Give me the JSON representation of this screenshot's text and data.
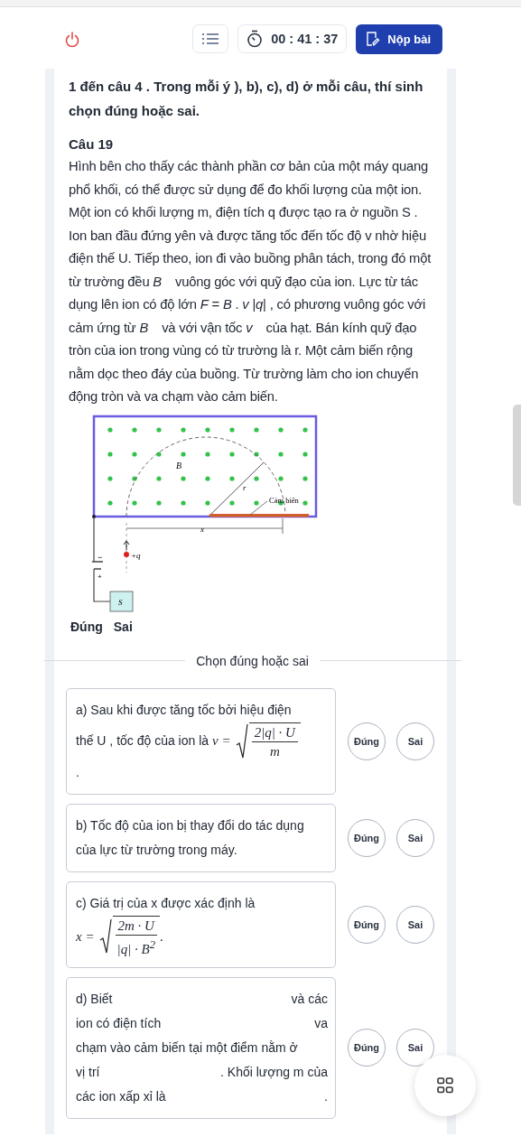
{
  "toolbar": {
    "timer": "00 : 41 : 37",
    "submit": "Nộp bài"
  },
  "instruction": "1 đến câu 4 . Trong mỗi ý     ), b), c), d) ở mỗi câu, thí sinh chọn đúng hoặc sai.",
  "question": {
    "title": "Câu 19",
    "paragraph": "Hình bên cho thấy các thành phần cơ bản của một máy quang phổ khối, có thể được sử dụng để đo khối lượng của một ion. Một ion có khối lượng m, điện tích q được tạo ra ở nguồn S . Ion ban đầu đứng yên và được tăng tốc đến tốc độ v nhờ hiệu điện thế U. Tiếp theo, ion đi vào buồng phân tách, trong đó một từ trường đều *B⃗* vuông góc với quỹ đạo của ion. Lực từ tác dụng lên ion có độ lớn *F* = *B* . *v* |*q*| , có phương vuông góc với cảm ứng từ *B⃗* và với vận tốc *v⃗* của hạt. Bán kính quỹ đạo tròn của ion trong vùng có từ trường là r. Một cảm biến rộng nằm dọc theo đáy của buồng. Từ trường làm cho ion chuyển động tròn và va chạm vào cảm biến.",
    "diagram": {
      "field": "B⃗",
      "radius": "r",
      "sensor": "Cảm biến",
      "distance": "x",
      "charge": "+q",
      "source": "S",
      "minus": "−",
      "plus": "+"
    },
    "answer_labels": [
      "Đúng",
      "Sai"
    ]
  },
  "section_title": "Chọn đúng hoặc sai",
  "statements": [
    {
      "lines": [
        {
          "kind": "text",
          "text": "a) Sau khi được tăng tốc bởi hiệu điện"
        },
        {
          "kind": "formula",
          "text": "thế U , tốc độ của ion là",
          "lhs": "v =",
          "num": "2|q| · U",
          "den": "m"
        },
        {
          "kind": "text",
          "text": "."
        }
      ],
      "options": [
        {
          "label": "Đúng",
          "selected": false
        },
        {
          "label": "Sai",
          "selected": false
        }
      ]
    },
    {
      "lines": [
        {
          "kind": "text",
          "text": "b) Tốc độ của ion bị thay đổi do tác dụng của lực từ trường trong máy."
        }
      ],
      "options": [
        {
          "label": "Đúng",
          "selected": false
        },
        {
          "label": "Sai",
          "selected": false
        }
      ]
    },
    {
      "lines": [
        {
          "kind": "text",
          "text": "c) Giá trị của x được xác định là"
        },
        {
          "kind": "formula",
          "lhs": "x =",
          "num": "2m · U",
          "den": "|q| · B$^{2}$",
          "tail": "."
        }
      ],
      "options": [
        {
          "label": "Đúng",
          "selected": false
        },
        {
          "label": "Sai",
          "selected": false
        }
      ]
    },
    {
      "lines": [
        {
          "kind": "split",
          "left": "d) Biết",
          "right": "và các"
        },
        {
          "kind": "split",
          "left": "ion có điện tích",
          "right": "va"
        },
        {
          "kind": "text",
          "text": "chạm vào cảm biến tại một điểm nằm ở"
        },
        {
          "kind": "split",
          "left": "vị trí",
          "right": ". Khối lượng m của"
        },
        {
          "kind": "split",
          "left": "các ion xấp xỉ là",
          "right": "."
        }
      ],
      "options": [
        {
          "label": "Đúng",
          "selected": false
        },
        {
          "label": "Sai",
          "selected": false
        }
      ]
    }
  ]
}
